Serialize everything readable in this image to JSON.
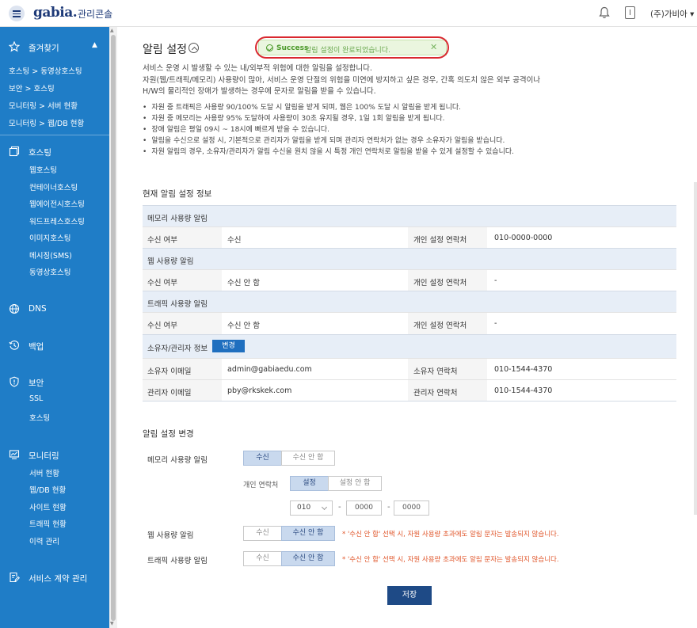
{
  "header": {
    "logo": "gabia.",
    "app_title": "관리콘솔",
    "user": "(주)가비아 ▾"
  },
  "sidebar": {
    "favorites_label": "즐겨찾기",
    "favorite_links": [
      "호스팅 > 동영상호스팅",
      "보안 > 호스팅",
      "모니터링 > 서버 현황",
      "모니터링 > 웹/DB 현황"
    ],
    "hosting": {
      "label": "호스팅",
      "items": [
        "웹호스팅",
        "컨테이너호스팅",
        "웹에이전시호스팅",
        "워드프레스호스팅",
        "이미지호스팅",
        "메시징(SMS)",
        "동영상호스팅"
      ]
    },
    "dns_label": "DNS",
    "backup_label": "백업",
    "security": {
      "label": "보안",
      "items": [
        "SSL",
        "호스팅"
      ]
    },
    "monitoring": {
      "label": "모니터링",
      "items": [
        "서버 현황",
        "웹/DB 현황",
        "사이트 현황",
        "트래픽 현황",
        "이력 관리"
      ]
    },
    "contract_label": "서비스 계약 관리"
  },
  "page": {
    "title": "알림 설정",
    "toast": {
      "strong": "Success",
      "message": "알림 설정이 완료되었습니다."
    },
    "description": [
      "서비스 운영 시 발생할 수 있는 내/외부적 위험에 대한 알림을 설정합니다.",
      "자원(웹/트래픽/메모리) 사용량이 많아, 서비스 운영 단절의 위험을 미연에 방지하고 싶은 경우, 간혹 의도치 않은 외부 공격이나",
      "H/W의 물리적인 장애가 발생하는 경우에 문자로 알림을 받을 수 있습니다."
    ],
    "bullets": [
      "자원 중 트래픽은 사용량 90/100% 도달 시 알림을 받게 되며, 웹은 100% 도달 시 알림을 받게 됩니다.",
      "자원 중 메모리는 사용량 95% 도달하여 사용량이 30초 유지될 경우, 1일 1회 알림을 받게 됩니다.",
      "장애 알림은 평일 09시 ~ 18시에 빠르게 받을 수 있습니다.",
      "알림을 수신으로 설정 시, 기본적으로 관리자가 알림을 받게 되며 관리자 연락처가 없는 경우 소유자가 알림을 받습니다.",
      "자원 알림의 경우, 소유자/관리자가 알림 수신을 원치 않을 시 특정 개인 연락처로 알림을 받을 수 있게 설정할 수 있습니다."
    ]
  },
  "info": {
    "section_title": "현재 알림 설정 정보",
    "memory": {
      "header": "메모리 사용량 알림",
      "receive_label": "수신 여부",
      "receive_value": "수신",
      "contact_label": "개인 설정 연락처",
      "contact_value": "010-0000-0000"
    },
    "web": {
      "header": "웹 사용량 알림",
      "receive_label": "수신 여부",
      "receive_value": "수신 안 함",
      "contact_label": "개인 설정 연락처",
      "contact_value": "-"
    },
    "traffic": {
      "header": "트래픽 사용량 알림",
      "receive_label": "수신 여부",
      "receive_value": "수신 안 함",
      "contact_label": "개인 설정 연락처",
      "contact_value": "-"
    },
    "owner": {
      "header": "소유자/관리자 정보",
      "change_button": "변경",
      "owner_email_label": "소유자 이메일",
      "owner_email": "admin@gabiaedu.com",
      "owner_phone_label": "소유자 연락처",
      "owner_phone": "010-1544-4370",
      "admin_email_label": "관리자 이메일",
      "admin_email": "pby@rkskek.com",
      "admin_phone_label": "관리자 연락처",
      "admin_phone": "010-1544-4370"
    }
  },
  "form": {
    "section_title": "알림 설정 변경",
    "memory_label": "메모리 사용량 알림",
    "web_label": "웹 사용량 알림",
    "traffic_label": "트래픽 사용량 알림",
    "receive_on": "수신",
    "receive_off": "수신 안 함",
    "personal_contact_label": "개인 연락처",
    "set_on": "설정",
    "set_off": "설정 안 함",
    "phone_prefix": "010",
    "phone_mid_placeholder": "0000",
    "phone_last_placeholder": "0000",
    "warning": "* '수신 안 함' 선택 시, 자원 사용량 초과에도 알림 문자는 발송되지 않습니다.",
    "save_button": "저장"
  },
  "colors": {
    "sidebar": "#1f7dc7",
    "primary_button": "#1e4a86",
    "toast_ring": "#d9282f",
    "warning": "#e0562b"
  }
}
